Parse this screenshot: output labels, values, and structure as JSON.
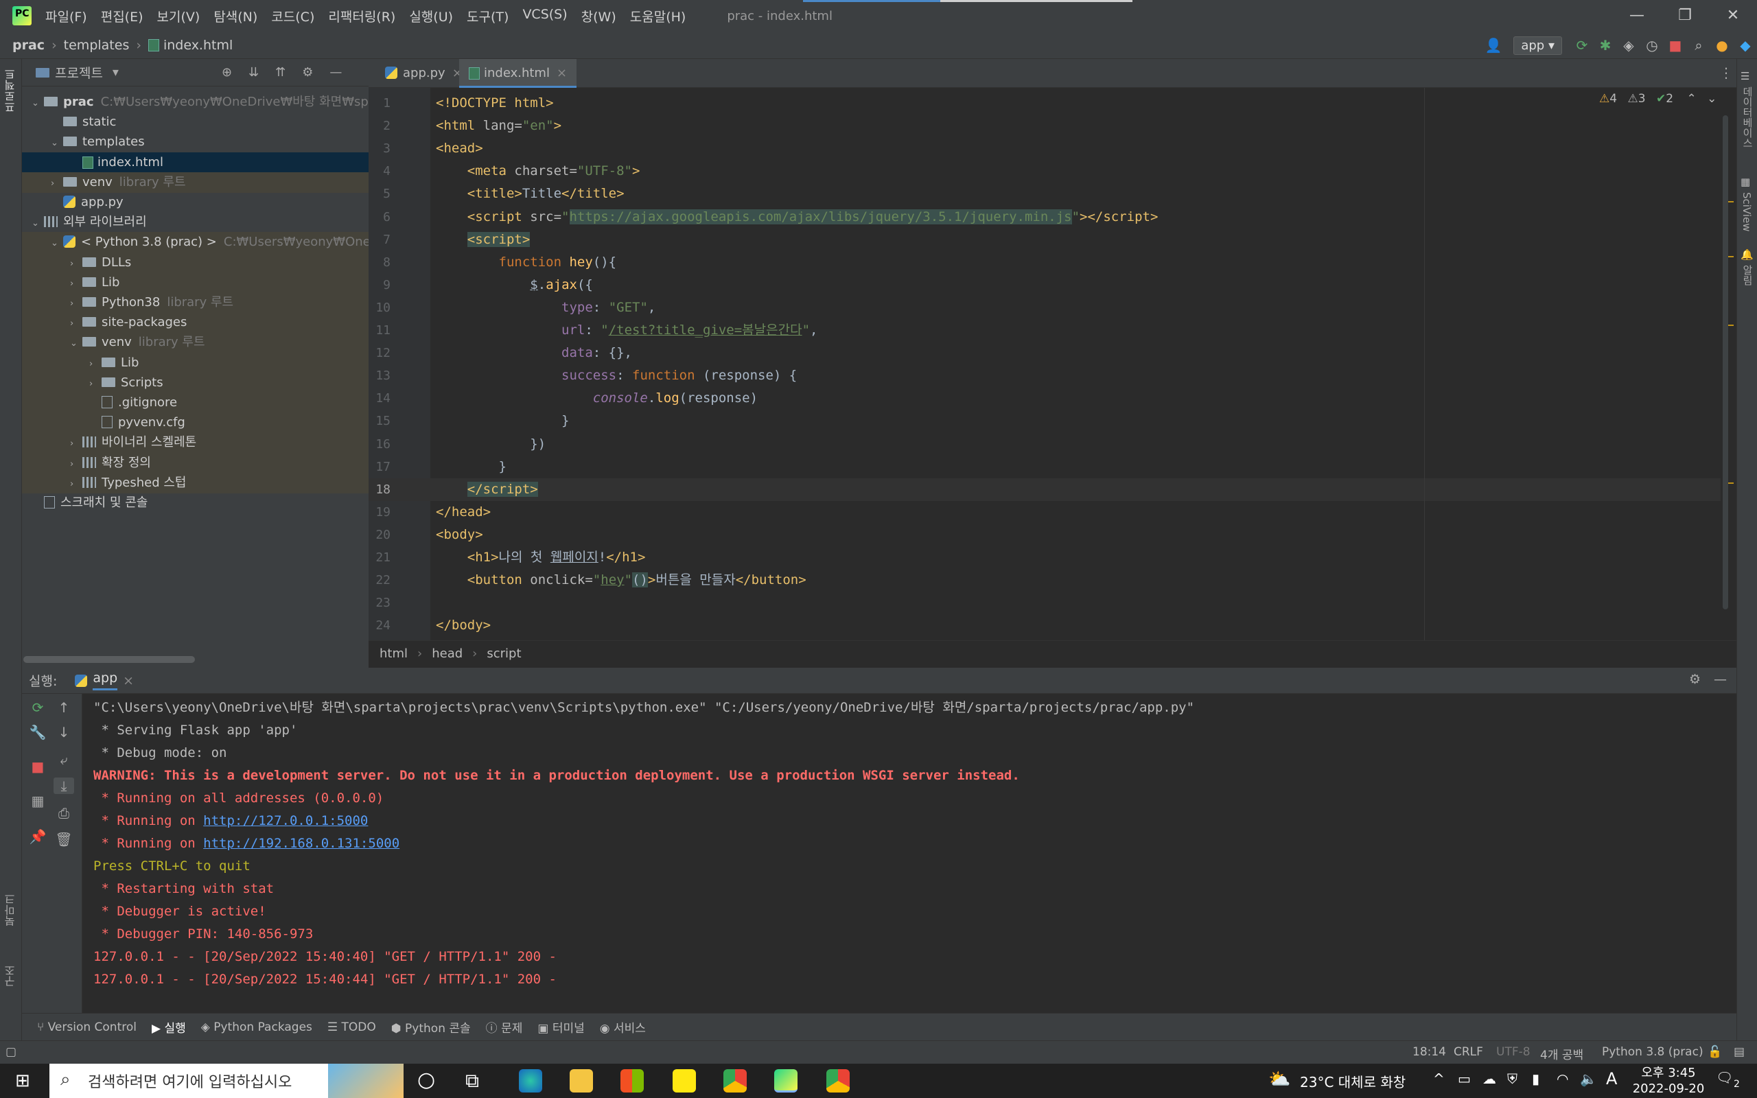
{
  "window": {
    "menu": [
      "파일(F)",
      "편집(E)",
      "보기(V)",
      "탐색(N)",
      "코드(C)",
      "리팩터링(R)",
      "실행(U)",
      "도구(T)",
      "VCS(S)",
      "창(W)",
      "도움말(H)"
    ],
    "title": "prac - index.html",
    "controls": [
      "—",
      "❐",
      "✕"
    ]
  },
  "nav": {
    "crumbs": [
      "prac",
      "templates",
      "index.html"
    ],
    "run_config": "app"
  },
  "project": {
    "title": "프로젝트",
    "rows": [
      {
        "indent": 0,
        "arrow": "⌄",
        "icon": "folder",
        "label": "prac",
        "dim": "C:₩Users₩yeony₩OneDrive₩바탕 화면₩sparta",
        "style": "bold"
      },
      {
        "indent": 1,
        "arrow": "",
        "icon": "folder",
        "label": "static",
        "dim": ""
      },
      {
        "indent": 1,
        "arrow": "⌄",
        "icon": "folder",
        "label": "templates",
        "dim": ""
      },
      {
        "indent": 2,
        "arrow": "",
        "icon": "html",
        "label": "index.html",
        "dim": "",
        "style": "sel"
      },
      {
        "indent": 1,
        "arrow": "›",
        "icon": "folder",
        "label": "venv",
        "dim": "library 루트",
        "style": "lib"
      },
      {
        "indent": 1,
        "arrow": "",
        "icon": "py",
        "label": "app.py",
        "dim": ""
      },
      {
        "indent": 0,
        "arrow": "⌄",
        "icon": "lib",
        "label": "외부 라이브러리",
        "dim": ""
      },
      {
        "indent": 1,
        "arrow": "⌄",
        "icon": "py",
        "label": "< Python 3.8 (prac) >",
        "dim": "C:₩Users₩yeony₩OneDrive",
        "style": "lib"
      },
      {
        "indent": 2,
        "arrow": "›",
        "icon": "folder",
        "label": "DLLs",
        "dim": "",
        "style": "lib"
      },
      {
        "indent": 2,
        "arrow": "›",
        "icon": "folder",
        "label": "Lib",
        "dim": "",
        "style": "lib"
      },
      {
        "indent": 2,
        "arrow": "›",
        "icon": "folder",
        "label": "Python38",
        "dim": "library 루트",
        "style": "lib"
      },
      {
        "indent": 2,
        "arrow": "›",
        "icon": "folder",
        "label": "site-packages",
        "dim": "",
        "style": "lib"
      },
      {
        "indent": 2,
        "arrow": "⌄",
        "icon": "folder",
        "label": "venv",
        "dim": "library 루트",
        "style": "lib"
      },
      {
        "indent": 3,
        "arrow": "›",
        "icon": "folder",
        "label": "Lib",
        "dim": "",
        "style": "lib"
      },
      {
        "indent": 3,
        "arrow": "›",
        "icon": "folder",
        "label": "Scripts",
        "dim": "",
        "style": "lib"
      },
      {
        "indent": 3,
        "arrow": "",
        "icon": "file",
        "label": ".gitignore",
        "dim": "",
        "style": "lib"
      },
      {
        "indent": 3,
        "arrow": "",
        "icon": "file",
        "label": "pyvenv.cfg",
        "dim": "",
        "style": "lib"
      },
      {
        "indent": 2,
        "arrow": "›",
        "icon": "lib",
        "label": "바이너리 스켈레톤",
        "dim": "",
        "style": "lib"
      },
      {
        "indent": 2,
        "arrow": "›",
        "icon": "lib",
        "label": "확장 정의",
        "dim": "",
        "style": "lib"
      },
      {
        "indent": 2,
        "arrow": "›",
        "icon": "lib",
        "label": "Typeshed 스텁",
        "dim": "",
        "style": "lib"
      },
      {
        "indent": 0,
        "arrow": "",
        "icon": "scratch",
        "label": "스크래치 및 콘솔",
        "dim": ""
      }
    ]
  },
  "tabs": [
    {
      "label": "app.py",
      "active": false
    },
    {
      "label": "index.html",
      "active": true
    }
  ],
  "editor": {
    "lines": [
      {
        "n": "1",
        "html": "<span class='tg'>&lt;!DOCTYPE html&gt;</span>"
      },
      {
        "n": "2",
        "html": "<span class='tg'>&lt;html </span><span class='at'>lang=</span><span class='st'>\"en\"</span><span class='tg'>&gt;</span>"
      },
      {
        "n": "3",
        "html": "<span class='tg'>&lt;head&gt;</span>"
      },
      {
        "n": "4",
        "html": "    <span class='tg'>&lt;meta </span><span class='at'>charset=</span><span class='st'>\"UTF-8\"</span><span class='tg'>&gt;</span>"
      },
      {
        "n": "5",
        "html": "    <span class='tg'>&lt;title&gt;</span>Title<span class='tg'>&lt;/title&gt;</span>"
      },
      {
        "n": "6",
        "html": "    <span class='tg'>&lt;script </span><span class='at'>src=</span><span class='st'>\"<span class='tgbg'>https://ajax.googleapis.com/ajax/libs/jquery/3.5.1/jquery.min.js</span>\"</span><span class='tg'>&gt;&lt;/script&gt;</span>"
      },
      {
        "n": "7",
        "html": "    <span class='tg tgbg'>&lt;script&gt;</span>"
      },
      {
        "n": "8",
        "html": "        <span class='kw'>function </span><span class='fn'>hey</span>(){"
      },
      {
        "n": "9",
        "html": "            <u>$</u>.<span class='fn'>ajax</span>({"
      },
      {
        "n": "10",
        "html": "                <span class='pr'>type</span>: <span class='st'>\"GET\"</span>,"
      },
      {
        "n": "11",
        "html": "                <span class='pr'>url</span>: <span class='st'>\"</span><span class='ul'>/test?title_give=봄날은간다</span><span class='st'>\"</span>,"
      },
      {
        "n": "12",
        "html": "                <span class='pr'>data</span>: {},"
      },
      {
        "n": "13",
        "html": "                <span class='pr'>success</span>: <span class='kw'>function </span>(response) {"
      },
      {
        "n": "14",
        "html": "                    <i class='pr'>console</i>.<span class='fn'>log</span>(response)"
      },
      {
        "n": "15",
        "html": "                }"
      },
      {
        "n": "16",
        "html": "            })"
      },
      {
        "n": "17",
        "html": "        }"
      },
      {
        "n": "18",
        "html": "    <span class='tg tgbg'>&lt;/script&gt;</span>"
      },
      {
        "n": "19",
        "html": "<span class='tg'>&lt;/head&gt;</span>"
      },
      {
        "n": "20",
        "html": "<span class='tg'>&lt;body&gt;</span>"
      },
      {
        "n": "21",
        "html": "    <span class='tg'>&lt;h1&gt;</span>나의 첫 <u>웹페이지</u>!<span class='tg'>&lt;/h1&gt;</span>"
      },
      {
        "n": "22",
        "html": "    <span class='tg'>&lt;button </span><span class='at'>onclick=</span><span class='st'>\"<u>hey</u>\"</span><span class='tgbg'>()</span><span class='tg'>&gt;</span>버튼을 만들자<span class='tg'>&lt;/button&gt;</span>"
      },
      {
        "n": "23",
        "html": ""
      },
      {
        "n": "24",
        "html": "<span class='tg'>&lt;/body&gt;</span>"
      }
    ],
    "current_line": 18,
    "inspections": {
      "warnings": "4",
      "weak": "3",
      "ok": "2"
    }
  },
  "breadcrumb": [
    "html",
    "head",
    "script"
  ],
  "run": {
    "label": "실행:",
    "tab": "app",
    "lines": [
      {
        "cls": "",
        "text": "\"C:\\Users\\yeony\\OneDrive\\바탕 화면\\sparta\\projects\\prac\\venv\\Scripts\\python.exe\" \"C:/Users/yeony/OneDrive/바탕 화면/sparta/projects/prac/app.py\""
      },
      {
        "cls": "",
        "text": " * Serving Flask app 'app'"
      },
      {
        "cls": "",
        "text": " * Debug mode: on"
      },
      {
        "cls": "redb",
        "text": "WARNING: This is a development server. Do not use it in a production deployment. Use a production WSGI server instead."
      },
      {
        "cls": "red",
        "text": " * Running on all addresses (0.0.0.0)"
      },
      {
        "cls": "red",
        "text": " * Running on ",
        "link": "http://127.0.0.1:5000"
      },
      {
        "cls": "red",
        "text": " * Running on ",
        "link": "http://192.168.0.131:5000"
      },
      {
        "cls": "yel",
        "text": "Press CTRL+C to quit"
      },
      {
        "cls": "red",
        "text": " * Restarting with stat"
      },
      {
        "cls": "red",
        "text": " * Debugger is active!"
      },
      {
        "cls": "red",
        "text": " * Debugger PIN: 140-856-973"
      },
      {
        "cls": "red",
        "text": "127.0.0.1 - - [20/Sep/2022 15:40:40] \"GET / HTTP/1.1\" 200 -"
      },
      {
        "cls": "red",
        "text": "127.0.0.1 - - [20/Sep/2022 15:40:44] \"GET / HTTP/1.1\" 200 -"
      }
    ]
  },
  "bottom_tabs": [
    "Version Control",
    "실행",
    "Python Packages",
    "TODO",
    "Python 콘솔",
    "문제",
    "터미널",
    "서비스"
  ],
  "status": {
    "position": "18:14",
    "line_sep": "CRLF",
    "encoding": "UTF-8",
    "indent": "4개 공백",
    "interpreter": "Python 3.8 (prac)"
  },
  "side_tabs": {
    "left_top": "프로젝트",
    "left_bottom1": "북마크",
    "left_bottom2": "구조",
    "right1": "데이터베이스",
    "right2": "SciView",
    "right3": "알림"
  },
  "taskbar": {
    "search_placeholder": "검색하려면 여기에 입력하십시오",
    "weather": "23°C 대체로 화창",
    "ime": "A",
    "time": "오후 3:45",
    "date": "2022-09-20",
    "notif_count": "2"
  }
}
